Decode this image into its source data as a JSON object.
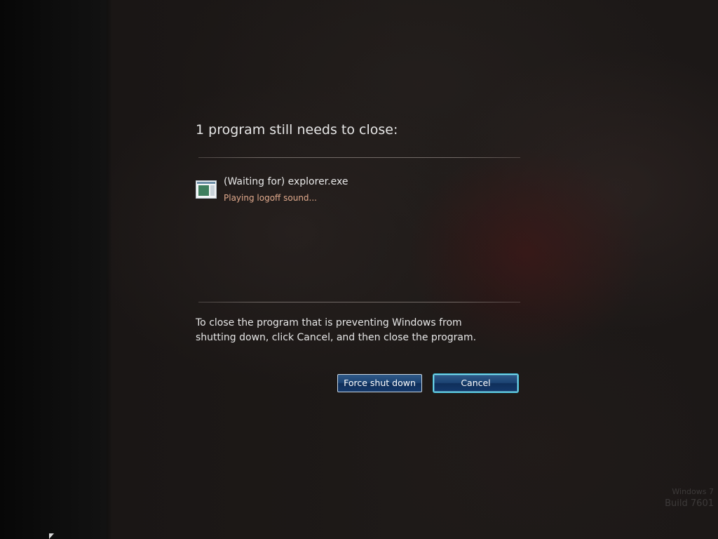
{
  "dialog": {
    "title": "1 program still needs to close:",
    "program": {
      "icon": "application-window-icon",
      "name": "(Waiting for) explorer.exe",
      "status": "Playing logoff sound..."
    },
    "message": "To close the program that is preventing Windows from shutting down, click Cancel, and then close the program.",
    "buttons": {
      "force_label": "Force shut down",
      "cancel_label": "Cancel"
    }
  },
  "watermark": {
    "line1": "Windows 7",
    "line2": "Build 7601"
  },
  "colors": {
    "status_text": "#e0a98c",
    "button_fill": "#1c4373",
    "focus_glow": "#7fe6f5"
  }
}
